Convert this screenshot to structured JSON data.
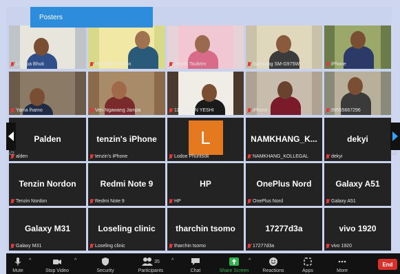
{
  "posters_label": "Posters",
  "page_indicator_left": "1/2",
  "page_indicator_right": "1/2",
  "tiles": [
    {
      "name": "Lhakpa Bhuti",
      "type": "video"
    },
    {
      "name": "Hepatitis Section",
      "type": "video"
    },
    {
      "name": "Tenzin Tsultrim",
      "type": "video"
    },
    {
      "name": "Samsung SM-G975W",
      "type": "video"
    },
    {
      "name": "iPhone",
      "type": "video",
      "active": true
    },
    {
      "name": "Yama lhamo",
      "type": "video"
    },
    {
      "name": "Ven Ngawang Jampa",
      "type": "video"
    },
    {
      "name": "11-TENZIN YESHI",
      "type": "video"
    },
    {
      "name": "iPhone",
      "type": "video"
    },
    {
      "name": "99555667296",
      "type": "video"
    },
    {
      "name": "Palden",
      "big": "Palden",
      "type": "name",
      "label": "alden"
    },
    {
      "name": "tenzin's iPhone",
      "big": "tenzin's iPhone",
      "type": "name"
    },
    {
      "name": "Lodoe Phuntsok",
      "avatar": "L",
      "type": "avatar"
    },
    {
      "name": "NAMKHANG_KOLLEGAL",
      "big": "NAMKHANG_K...",
      "type": "name"
    },
    {
      "name": "dekyi",
      "big": "dekyi",
      "type": "name"
    },
    {
      "name": "Tenzin Nordon",
      "big": "Tenzin Nordon",
      "type": "name"
    },
    {
      "name": "Redmi Note 9",
      "big": "Redmi Note 9",
      "type": "name"
    },
    {
      "name": "HP",
      "big": "HP",
      "type": "name"
    },
    {
      "name": "OnePlus Nord",
      "big": "OnePlus Nord",
      "type": "name"
    },
    {
      "name": "Galaxy A51",
      "big": "Galaxy A51",
      "type": "name"
    },
    {
      "name": "Galaxy M31",
      "big": "Galaxy M31",
      "type": "name"
    },
    {
      "name": "Loseling clinic",
      "big": "Loseling clinic",
      "type": "name"
    },
    {
      "name": "tharchin tsomo",
      "big": "tharchin tsomo",
      "type": "name"
    },
    {
      "name": "17277d3a",
      "big": "17277d3a",
      "type": "name"
    },
    {
      "name": "vivo 1920",
      "big": "vivo 1920",
      "type": "name"
    }
  ],
  "toolbar": {
    "mute": "Mute",
    "stop_video": "Stop Video",
    "security": "Security",
    "participants": "Participants",
    "participants_count": "35",
    "chat": "Chat",
    "share_screen": "Share Screen",
    "reactions": "Reactions",
    "apps": "Apps",
    "more": "More",
    "end": "End"
  },
  "colors": {
    "share_green": "#2fb34a",
    "end_red": "#d9302c",
    "active_speaker": "#bdd82d",
    "avatar_orange": "#e5791f",
    "posters_blue": "#2d8cdb"
  }
}
